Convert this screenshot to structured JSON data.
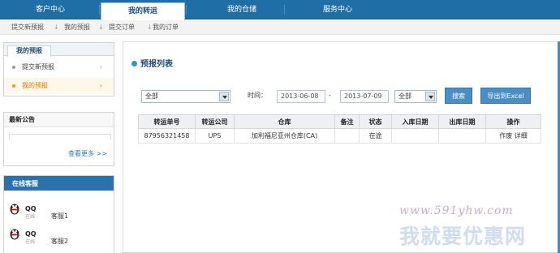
{
  "topnav": {
    "tabs": [
      {
        "label": "客户中心"
      },
      {
        "label": "我的转运"
      },
      {
        "label": "我的仓储"
      },
      {
        "label": "服务中心"
      }
    ]
  },
  "subnav": {
    "links": [
      "提交新预报",
      "我的预报",
      "提交订单",
      "我的订单"
    ],
    "sep": "↓"
  },
  "sidebar": {
    "title": "我的预报",
    "items": [
      {
        "label": "提交新预报",
        "chev": "›"
      },
      {
        "label": "我的预报",
        "chev": "›"
      }
    ]
  },
  "notice": {
    "title": "最新公告",
    "more": "查看更多 >>"
  },
  "service": {
    "title": "在线客服",
    "agents": [
      {
        "qq": "QQ",
        "small": "在线",
        "name": "客服1"
      },
      {
        "qq": "QQ",
        "small": "在线",
        "name": "客服2"
      }
    ]
  },
  "main": {
    "title": "预报列表",
    "filter": {
      "warehouse": "全部",
      "time_label": "时间：",
      "date_from": "2013-06-08",
      "dash": "-",
      "date_to": "2013-07-09",
      "status": "全部",
      "search_label": "搜索",
      "export_label": "导出到Excel"
    },
    "table": {
      "headers": [
        "转运单号",
        "转运公司",
        "仓库",
        "备注",
        "状态",
        "入库日期",
        "出库日期",
        "操作"
      ],
      "rows": [
        [
          "87956321458",
          "UPS",
          "加利福尼亚州仓库(CA)",
          "",
          "在途",
          "",
          "",
          "作废 详细"
        ]
      ]
    }
  },
  "watermark": {
    "url": "www.591yhw.com",
    "text": "我就要优惠网"
  },
  "colors": {
    "nav_blue": "#1f6fa6",
    "accent_orange": "#e07b00",
    "button_blue": "#4a8ec3"
  }
}
